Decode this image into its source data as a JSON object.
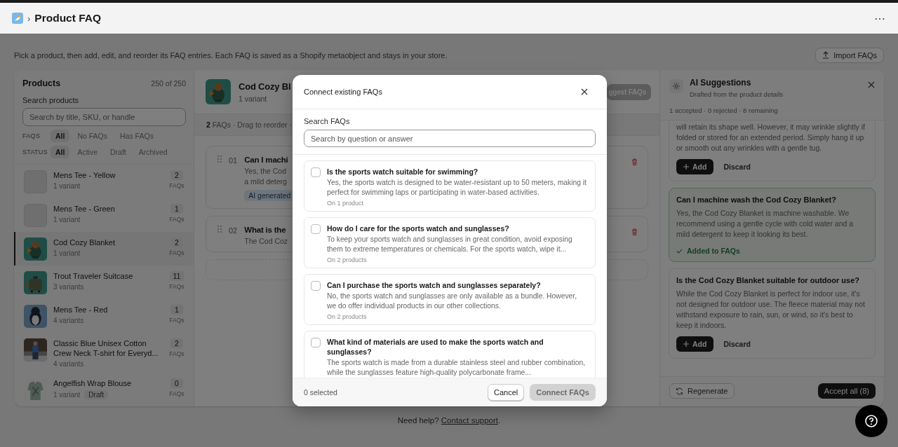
{
  "topbar": {
    "separator": "›",
    "title": "Product FAQ",
    "menu": "⋯"
  },
  "intro": "Pick a product, then add, edit, and reorder its FAQ entries. Each FAQ is saved as a Shopify metaobject and stays in your store.",
  "import_button": "Import FAQs",
  "products": {
    "title": "Products",
    "count": "250 of 250",
    "search_label": "Search products",
    "search": {
      "placeholder": "Search by title, SKU, or handle"
    },
    "filters": [
      {
        "label": "FAQS",
        "options": [
          {
            "label": "All",
            "selected": true
          },
          {
            "label": "No FAQs",
            "selected": false
          },
          {
            "label": "Has FAQs",
            "selected": false
          }
        ]
      },
      {
        "label": "STATUS",
        "options": [
          {
            "label": "All",
            "selected": true
          },
          {
            "label": "Active",
            "selected": false
          },
          {
            "label": "Draft",
            "selected": false
          },
          {
            "label": "Archived",
            "selected": false
          }
        ]
      }
    ],
    "items": [
      {
        "name": "Mens Tee - Yellow",
        "variants": "1 variant",
        "faq_count": "2",
        "faq_unit": "FAQs",
        "kind": "placeholder",
        "selected": false
      },
      {
        "name": "Mens Tee - Green",
        "variants": "1 variant",
        "faq_count": "1",
        "faq_unit": "FAQs",
        "kind": "placeholder",
        "selected": false
      },
      {
        "name": "Cod Cozy Blanket",
        "variants": "1 variant",
        "faq_count": "2",
        "faq_unit": "FAQs",
        "kind": "picture",
        "selected": true
      },
      {
        "name": "Trout Traveler Suitcase",
        "variants": "3 variants",
        "faq_count": "11",
        "faq_unit": "FAQs",
        "kind": "picture",
        "selected": false
      },
      {
        "name": "Mens Tee - Red",
        "variants": "4 variants",
        "faq_count": "1",
        "faq_unit": "FAQs",
        "kind": "picture",
        "selected": false
      },
      {
        "name": "Classic Blue Unisex Cotton Crew Neck T-shirt for Everyd...",
        "variants": "4 variants",
        "faq_count": "2",
        "faq_unit": "FAQs",
        "kind": "picture",
        "selected": false
      },
      {
        "name": "Angelfish Wrap Blouse",
        "variants": "1 variant",
        "status": "Draft",
        "faq_count": "0",
        "faq_unit": "FAQs",
        "kind": "picture",
        "selected": false
      }
    ]
  },
  "editor": {
    "title": "Cod Cozy Bl",
    "variants": "1 variant",
    "suggest_button": "ggest FAQs",
    "summary": "**2** FAQs · Drag to reorder ·",
    "faqs": [
      {
        "number": "01",
        "question": "Can I machi",
        "answer_lines": [
          "Yes, the Cod",
          "a mild deterg"
        ],
        "tag": "AI generated"
      },
      {
        "number": "02",
        "question": "What is the",
        "answer_lines": [
          "The Cod Coz"
        ]
      }
    ]
  },
  "ai": {
    "title": "AI Suggestions",
    "subtitle": "Drafted from the product details",
    "stats": "1 accepted · 0 rejected · 8 remaining",
    "suggestions": [
      {
        "answer": "will retain its shape well. However, it may wrinkle slightly if folded or stored for an extended period. Simply hang it up or smooth out any wrinkles with a gentle tug.",
        "accepted": false,
        "add": "Add",
        "discard": "Discard"
      },
      {
        "question": "Can I machine wash the Cod Cozy Blanket?",
        "answer": "Yes, the Cod Cozy Blanket is machine washable. We recommend using a gentle cycle with cold water and a mild detergent to keep it looking its best.",
        "accepted": true,
        "status": "Added to FAQs"
      },
      {
        "question": "Is the Cod Cozy Blanket suitable for outdoor use?",
        "answer": "While the Cod Cozy Blanket is perfect for indoor use, it's not designed for outdoor use. The fleece material may not withstand exposure to rain, sun, or wind, so it's best to keep it indoors.",
        "accepted": false,
        "add": "Add",
        "discard": "Discard"
      }
    ],
    "regenerate": "Regenerate",
    "accept_all": "Accept all (8)"
  },
  "modal": {
    "title": "Connect existing FAQs",
    "search_label": "Search FAQs",
    "search": {
      "placeholder": "Search by question or answer"
    },
    "items": [
      {
        "question": "Is the sports watch suitable for swimming?",
        "answer": "Yes, the sports watch is designed to be water-resistant up to 50 meters, making it perfect for swimming laps or participating in water-based activities.",
        "usage": "On 1 product",
        "checked": false
      },
      {
        "question": "How do I care for the sports watch and sunglasses?",
        "answer": "To keep your sports watch and sunglasses in great condition, avoid exposing them to extreme temperatures or chemicals. For the sports watch, wipe it...",
        "usage": "On 2 products",
        "checked": false
      },
      {
        "question": "Can I purchase the sports watch and sunglasses separately?",
        "answer": "No, the sports watch and sunglasses are only available as a bundle. However, we do offer individual products in our other collections.",
        "usage": "On 2 products",
        "checked": false
      },
      {
        "question": "What kind of materials are used to make the sports watch and sunglasses?",
        "answer": "The sports watch is made from a durable stainless steel and rubber combination, while the sunglasses feature high-quality polycarbonate frame...",
        "checked": false
      }
    ],
    "selected_count": "0 selected",
    "cancel": "Cancel",
    "connect": {
      "label": "Connect FAQs",
      "disabled": true
    }
  },
  "footer": {
    "text": "Need help?",
    "link": "Contact support",
    "end": "."
  }
}
